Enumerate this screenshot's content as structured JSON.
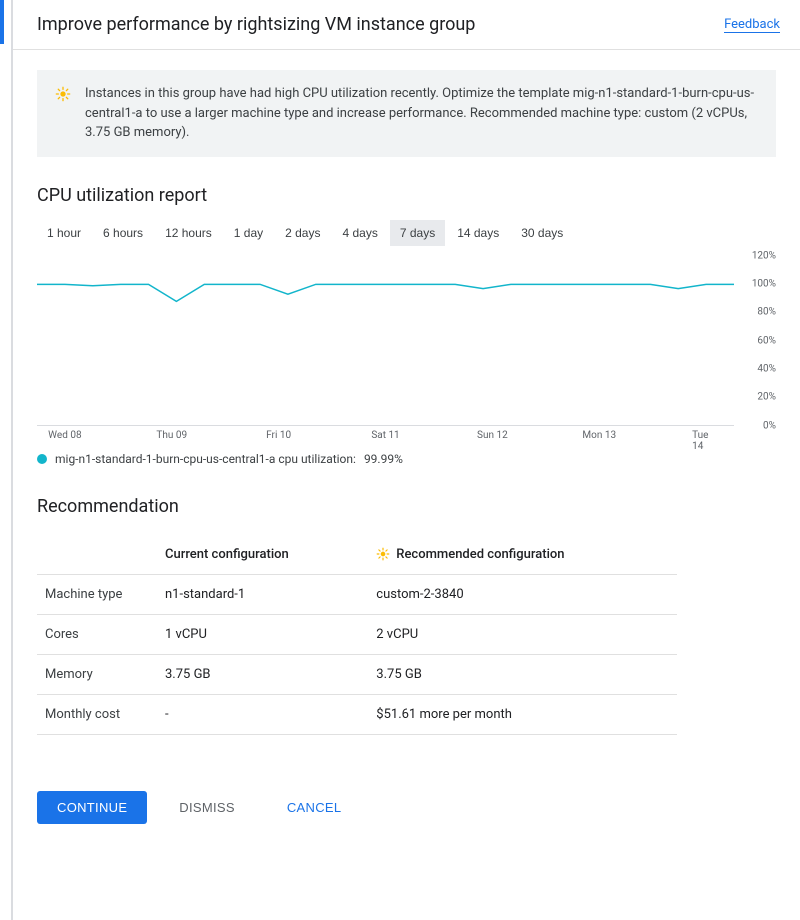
{
  "header": {
    "title": "Improve performance by rightsizing VM instance group",
    "feedback_label": "Feedback"
  },
  "alert": {
    "text": "Instances in this group have had high CPU utilization recently. Optimize the template mig-n1-standard-1-burn-cpu-us-central1-a to use a larger machine type and increase performance. Recommended machine type: custom (2 vCPUs, 3.75 GB memory)."
  },
  "cpu_report": {
    "heading": "CPU utilization report",
    "time_ranges": [
      "1 hour",
      "6 hours",
      "12 hours",
      "1 day",
      "2 days",
      "4 days",
      "7 days",
      "14 days",
      "30 days"
    ],
    "selected_range": "7 days",
    "legend_label": "mig-n1-standard-1-burn-cpu-us-central1-a cpu utilization:",
    "legend_value": "99.99%"
  },
  "chart_data": {
    "type": "line",
    "title": "CPU utilization report",
    "xlabel": "",
    "ylabel": "",
    "ylim": [
      0,
      120
    ],
    "y_ticks": [
      0,
      20,
      40,
      60,
      80,
      100,
      120
    ],
    "x_ticks": [
      "Wed 08",
      "Thu 09",
      "Fri 10",
      "Sat 11",
      "Sun 12",
      "Mon 13",
      "Tue 14"
    ],
    "series": [
      {
        "name": "mig-n1-standard-1-burn-cpu-us-central1-a cpu utilization",
        "color": "#12b5cb",
        "values": [
          100,
          100,
          99,
          100,
          100,
          88,
          100,
          100,
          100,
          93,
          100,
          100,
          100,
          100,
          100,
          100,
          97,
          100,
          100,
          100,
          100,
          100,
          100,
          97,
          100,
          100
        ]
      }
    ]
  },
  "recommendation": {
    "heading": "Recommendation",
    "columns": {
      "current": "Current configuration",
      "recommended": "Recommended configuration"
    },
    "rows": [
      {
        "label": "Machine type",
        "current": "n1-standard-1",
        "recommended": "custom-2-3840"
      },
      {
        "label": "Cores",
        "current": "1 vCPU",
        "recommended": "2 vCPU"
      },
      {
        "label": "Memory",
        "current": "3.75 GB",
        "recommended": "3.75 GB"
      },
      {
        "label": "Monthly cost",
        "current": "-",
        "recommended": "$51.61 more per month"
      }
    ]
  },
  "actions": {
    "continue": "Continue",
    "dismiss": "Dismiss",
    "cancel": "Cancel"
  }
}
